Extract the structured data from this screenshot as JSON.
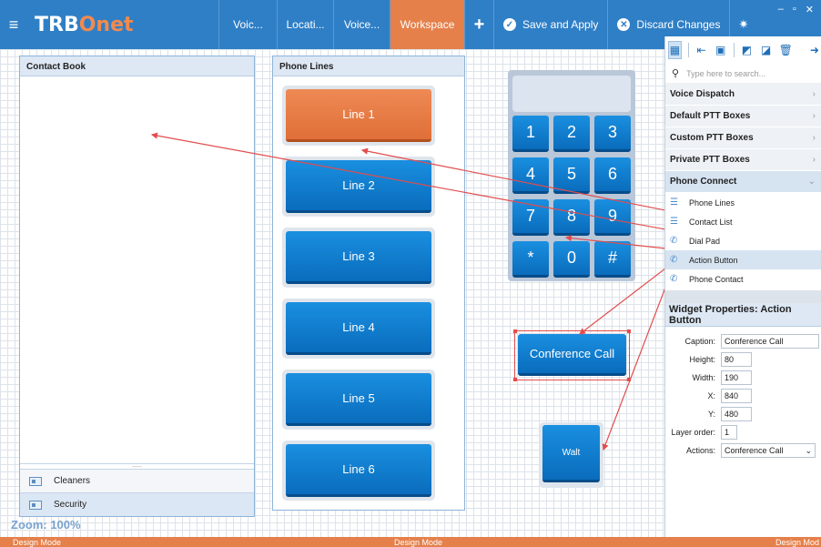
{
  "app": {
    "logo_main": "TRB",
    "logo_accent": "Onet"
  },
  "tabs": [
    "Voic...",
    "Locati...",
    "Voice...",
    "Workspace"
  ],
  "toolbar_actions": {
    "save": "Save and Apply",
    "discard": "Discard Changes"
  },
  "contact_book": {
    "title": "Contact Book",
    "items": [
      "Cleaners",
      "Security"
    ]
  },
  "phone_lines": {
    "title": "Phone Lines",
    "lines": [
      "Line 1",
      "Line 2",
      "Line 3",
      "Line 4",
      "Line 5",
      "Line 6"
    ]
  },
  "dialpad": {
    "keys": [
      "1",
      "2",
      "3",
      "4",
      "5",
      "6",
      "7",
      "8",
      "9",
      "*",
      "0",
      "#"
    ]
  },
  "conference_button": "Conference Call",
  "walt_button": "Walt",
  "zoom": "Zoom: 100%",
  "side": {
    "search_placeholder": "Type here to search...",
    "categories": [
      "Voice Dispatch",
      "Default PTT Boxes",
      "Custom PTT Boxes",
      "Private PTT Boxes",
      "Phone Connect"
    ],
    "widgets": [
      "Phone Lines",
      "Contact List",
      "Dial Pad",
      "Action Button",
      "Phone Contact"
    ],
    "properties_title": "Widget Properties: Action Button",
    "properties": {
      "caption_label": "Caption:",
      "caption": "Conference Call",
      "height_label": "Height:",
      "height": "80",
      "width_label": "Width:",
      "width": "190",
      "x_label": "X:",
      "x": "840",
      "y_label": "Y:",
      "y": "480",
      "layer_label": "Layer order:",
      "layer": "1",
      "actions_label": "Actions:",
      "actions": "Conference Call"
    }
  },
  "status": {
    "left": "Design Mode",
    "center": "Design Mode",
    "right": "Design Mod"
  },
  "colors": {
    "header": "#2f7fc6",
    "accent": "#e5804a",
    "button": "#0a7bd1"
  }
}
